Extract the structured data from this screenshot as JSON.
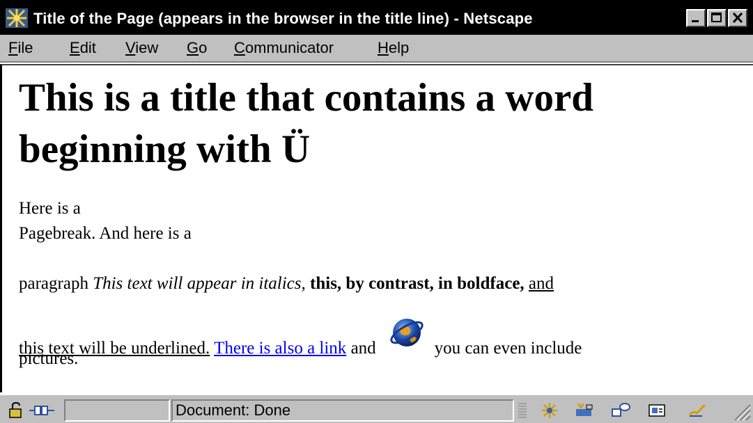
{
  "window": {
    "title": "Title of the Page (appears in the browser in the title line) - Netscape",
    "app_icon": "netscape-star-icon",
    "buttons": [
      "minimize",
      "maximize",
      "close"
    ]
  },
  "menu": {
    "file": {
      "acc": "F",
      "rest": "ile"
    },
    "edit": {
      "acc": "E",
      "rest": "dit"
    },
    "view": {
      "acc": "V",
      "rest": "iew"
    },
    "go": {
      "acc": "G",
      "rest": "o"
    },
    "communicator": {
      "acc": "C",
      "rest": "ommunicator"
    },
    "help": {
      "acc": "H",
      "rest": "elp"
    }
  },
  "page": {
    "heading": "This is a title that contains a word beginning with Ü",
    "line1": "Here is a",
    "line2": "Pagebreak. And here is a",
    "line3_plain": "paragraph ",
    "italic_text": "This text will appear in italics,",
    "bold_text": "this, by contrast, in boldface,",
    "underline_part1": "and",
    "underline_part2": "this text will be underlined.",
    "link_text": "There is also a link",
    "after_link": " and",
    "after_picture": "you can even include",
    "line5": "pictures."
  },
  "status": {
    "text": "Document: Done",
    "colors": {
      "chrome": "#c0c0c0",
      "title_bg": "#000000",
      "link": "#0000ee"
    }
  }
}
